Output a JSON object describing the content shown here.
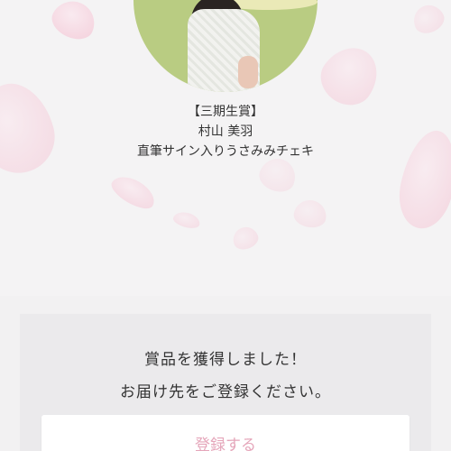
{
  "prize": {
    "tier": "【三期生賞】",
    "member": "村山 美羽",
    "item": "直筆サイン入りうさみみチェキ"
  },
  "result": {
    "line1": "賞品を獲得しました！",
    "line2": "お届け先をご登録ください。"
  },
  "actions": {
    "register_label": "登録する"
  },
  "colors": {
    "accent": "#e5a6ba",
    "petal": "#f7d3df",
    "avatar_bg": "#b9cc82"
  }
}
